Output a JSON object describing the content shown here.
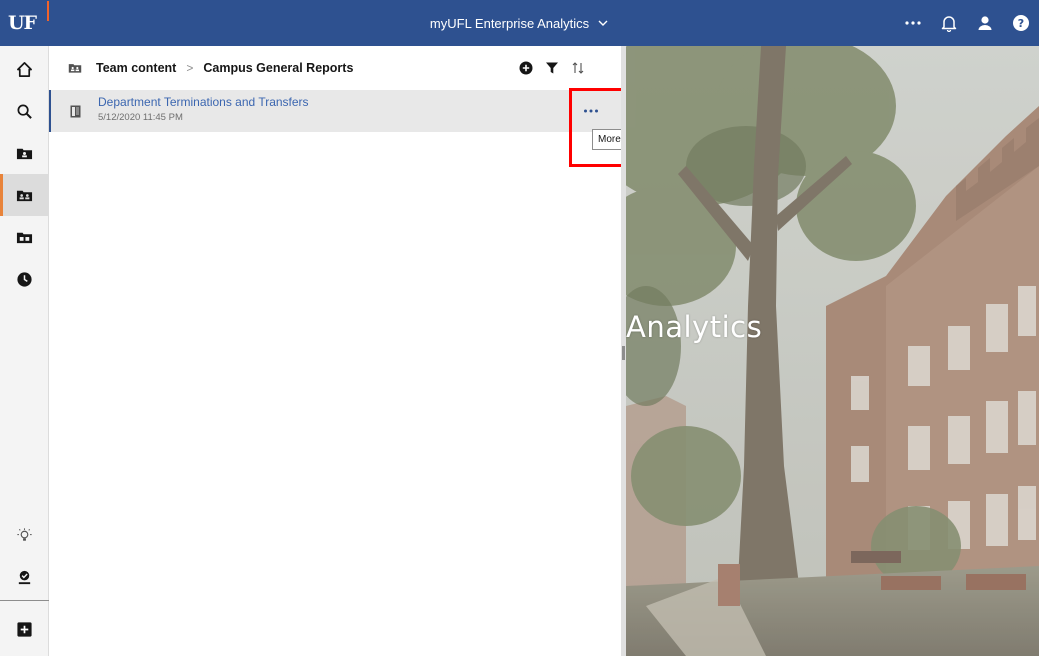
{
  "topbar": {
    "logo_text": "UF",
    "app_title": "myUFL Enterprise Analytics",
    "icons": [
      "more-horizontal-icon",
      "bell-icon",
      "user-icon",
      "help-icon"
    ]
  },
  "rail": {
    "items": [
      {
        "name": "home",
        "icon": "home-icon"
      },
      {
        "name": "search",
        "icon": "search-icon"
      },
      {
        "name": "my-content",
        "icon": "my-content-folder-icon"
      },
      {
        "name": "team-content",
        "icon": "team-folder-icon",
        "active": true
      },
      {
        "name": "samples",
        "icon": "samples-folder-icon"
      },
      {
        "name": "recent",
        "icon": "clock-icon"
      },
      {
        "name": "ideas",
        "icon": "lightbulb-icon"
      },
      {
        "name": "profile",
        "icon": "user-badge-icon"
      },
      {
        "name": "new",
        "icon": "plus-icon"
      }
    ]
  },
  "breadcrumb": {
    "root": "Team content",
    "separator": ">",
    "current": "Campus General Reports"
  },
  "toolbar": {
    "icons": [
      "add-icon",
      "filter-icon",
      "sort-icon"
    ]
  },
  "list": {
    "items": [
      {
        "title": "Department Terminations and Transfers",
        "date": "5/12/2020 11:45 PM",
        "icon": "report-icon"
      }
    ]
  },
  "tooltip": {
    "text": "More"
  },
  "welcome": {
    "title": "Analytics"
  },
  "colors": {
    "brand_blue": "#2e5190",
    "uf_orange": "#f2632a",
    "link_blue": "#3b66b0",
    "highlight_red": "#ff0000",
    "rail_active_orange": "#e8833a"
  }
}
